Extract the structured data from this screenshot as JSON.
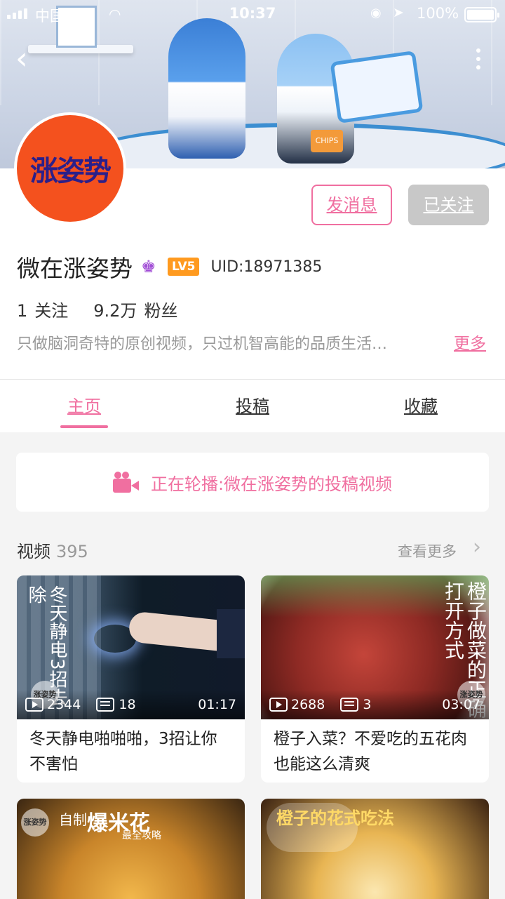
{
  "status_bar": {
    "carrier": "中国移动",
    "time": "10:37",
    "battery": "100%"
  },
  "profile": {
    "avatar_text": "涨姿势",
    "message_button": "发消息",
    "follow_button": "已关注",
    "name": "微在涨姿势",
    "level": "LV5",
    "uid": "UID:18971385",
    "following_count": "1",
    "following_label": "关注",
    "fans_count": "9.2万",
    "fans_label": "粉丝",
    "bio": "只做脑洞奇特的原创视频，只过机智高能的品质生活…",
    "more_link": "更多"
  },
  "tabs": [
    {
      "label": "主页",
      "active": true
    },
    {
      "label": "投稿",
      "active": false
    },
    {
      "label": "收藏",
      "active": false
    }
  ],
  "now_playing": "正在轮播:微在涨姿势的投稿视频",
  "videos_section": {
    "title": "视频",
    "count": "395",
    "see_more": "查看更多"
  },
  "videos": [
    {
      "overlay_text": "冬天静电3招去除",
      "watermark": "涨姿势",
      "plays": "2344",
      "comments": "18",
      "duration": "01:17",
      "title": "冬天静电啪啪啪，3招让你不害怕"
    },
    {
      "overlay_text": "橙子做菜的正确打开方式",
      "watermark": "涨姿势",
      "plays": "2688",
      "comments": "3",
      "duration": "03:07",
      "title": "橙子入菜？不爱吃的五花肉也能这么清爽"
    },
    {
      "watermark": "涨姿势",
      "overlay_label": "自制",
      "overlay_big": "爆米花",
      "overlay_sub": "最全攻略"
    },
    {
      "overlay_text": "橙子的花式吃法"
    }
  ],
  "colors": {
    "accent": "#f06fa0",
    "avatar_bg": "#f4511e",
    "level_badge": "#ff9a1f"
  }
}
